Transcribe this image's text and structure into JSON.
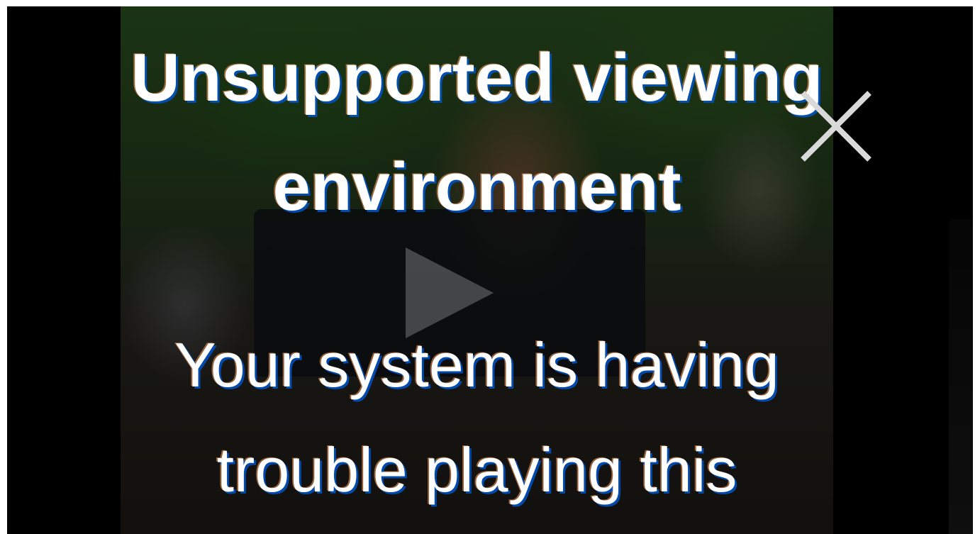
{
  "dialog": {
    "title": "Unsupported viewing environment",
    "message": "Your system is having trouble playing this"
  },
  "icons": {
    "close": "close-icon",
    "play": "play-icon"
  },
  "colors": {
    "background": "#000000",
    "text": "#ffffff",
    "close_icon": "#d9d9d9"
  }
}
